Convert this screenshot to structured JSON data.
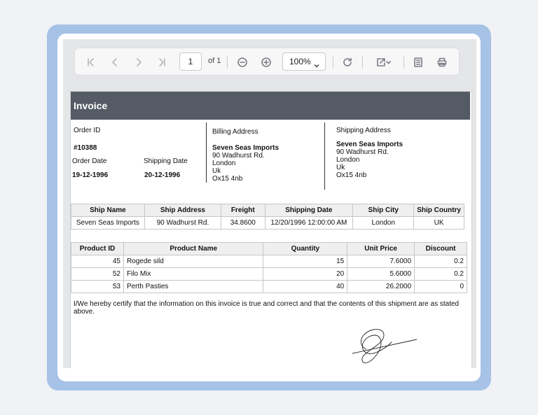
{
  "toolbar": {
    "page_value": "1",
    "page_of": "of 1",
    "zoom": "100%"
  },
  "invoice": {
    "title": "Invoice",
    "order_id_label": "Order ID",
    "order_id": "#10388",
    "order_date_label": "Order Date",
    "order_date": "19-12-1996",
    "shipping_date_label": "Shipping Date",
    "shipping_date": "20-12-1996",
    "billing_label": "Billing Address",
    "billing_lines": [
      "Seven Seas Imports",
      "90 Wadhurst Rd.",
      "London",
      "Uk",
      "Ox15 4nb"
    ],
    "shipping_label": "Shipping Address",
    "shipping_lines": [
      "Seven Seas Imports",
      "90 Wadhurst Rd.",
      "London",
      "Uk",
      "Ox15 4nb"
    ]
  },
  "ship_table": {
    "headers": [
      "Ship Name",
      "Ship Address",
      "Freight",
      "Shipping Date",
      "Ship City",
      "Ship Country"
    ],
    "row": [
      "Seven Seas Imports",
      "90 Wadhurst Rd.",
      "34.8600",
      "12/20/1996 12:00:00 AM",
      "London",
      "UK"
    ]
  },
  "product_table": {
    "headers": [
      "Product ID",
      "Product Name",
      "Quantity",
      "Unit Price",
      "Discount"
    ],
    "rows": [
      [
        "45",
        "Rogede sild",
        "15",
        "7.6000",
        "0.2"
      ],
      [
        "52",
        "Filo Mix",
        "20",
        "5.6000",
        "0.2"
      ],
      [
        "53",
        "Perth Pasties",
        "40",
        "26.2000",
        "0"
      ]
    ]
  },
  "certification": "I/We hereby certify that the information on this invoice is true and correct and that the contents of this shipment are as stated above."
}
